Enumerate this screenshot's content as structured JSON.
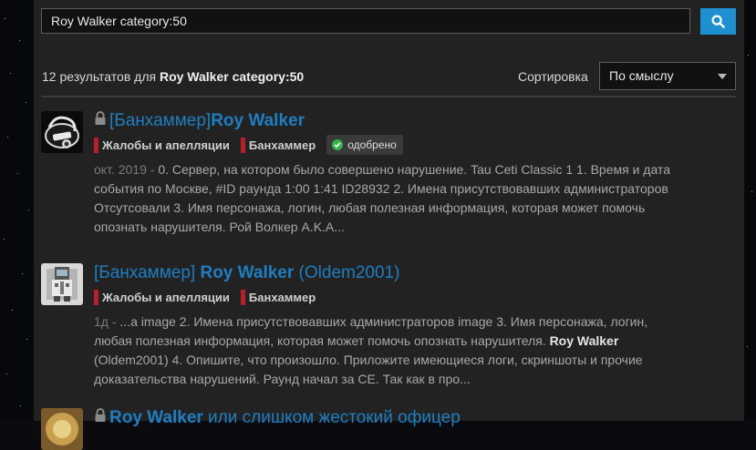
{
  "search": {
    "query": "Roy Walker category:50"
  },
  "results_header": {
    "count_prefix": "12 результатов для",
    "query_bold": "Roy Walker category:50",
    "sort_label": "Сортировка",
    "sort_value": "По смыслу"
  },
  "results": [
    {
      "title_prefix": "[Банхаммер]",
      "title_bold": "Roy Walker",
      "title_suffix": "",
      "locked": true,
      "tags": [
        "Жалобы и апелляции",
        "Банхаммер"
      ],
      "status_badge": "одобрено",
      "date": "окт. 2019",
      "snippet": "0. Сервер, на котором было совершено нарушение. Tau Ceti Classic 1 1. Время и дата события по Москве, #ID раунда 1:00 1:41 ID28932 2. Имена присутствовавших администраторов Отсутсовали 3. Имя персонажа, логин, любая полезная информация, которая может помочь опознать нарушителя. Рой Волкер A.K.A..."
    },
    {
      "title_prefix": "[Банхаммер] ",
      "title_bold": "Roy Walker",
      "title_suffix": " (Oldem2001)",
      "locked": false,
      "tags": [
        "Жалобы и апелляции",
        "Банхаммер"
      ],
      "date": "1д",
      "snippet_part1": "...a image 2. Имена присутствовавших администраторов image 3. Имя персонажа, логин, любая полезная информация, которая может помочь опознать нарушителя. ",
      "snippet_bold": "Roy Walker",
      "snippet_part2": " (Oldem2001) 4. Опишите, что произошло. Приложите имеющиеся логи, скриншоты и прочие доказательства нарушений. Раунд начал за СЕ. Так как в про..."
    },
    {
      "title_bold": "Roy Walker",
      "title_suffix": " или слишком жестокий офицер",
      "locked": true
    }
  ],
  "colors": {
    "accent": "#1e90d0",
    "link": "#1f7ec2",
    "tag_bar": "#b5202a",
    "approved": "#35b34a"
  },
  "icons": {
    "search": "search-icon",
    "lock": "lock-icon",
    "check": "check-icon",
    "dropdown": "chevron-down-icon"
  }
}
